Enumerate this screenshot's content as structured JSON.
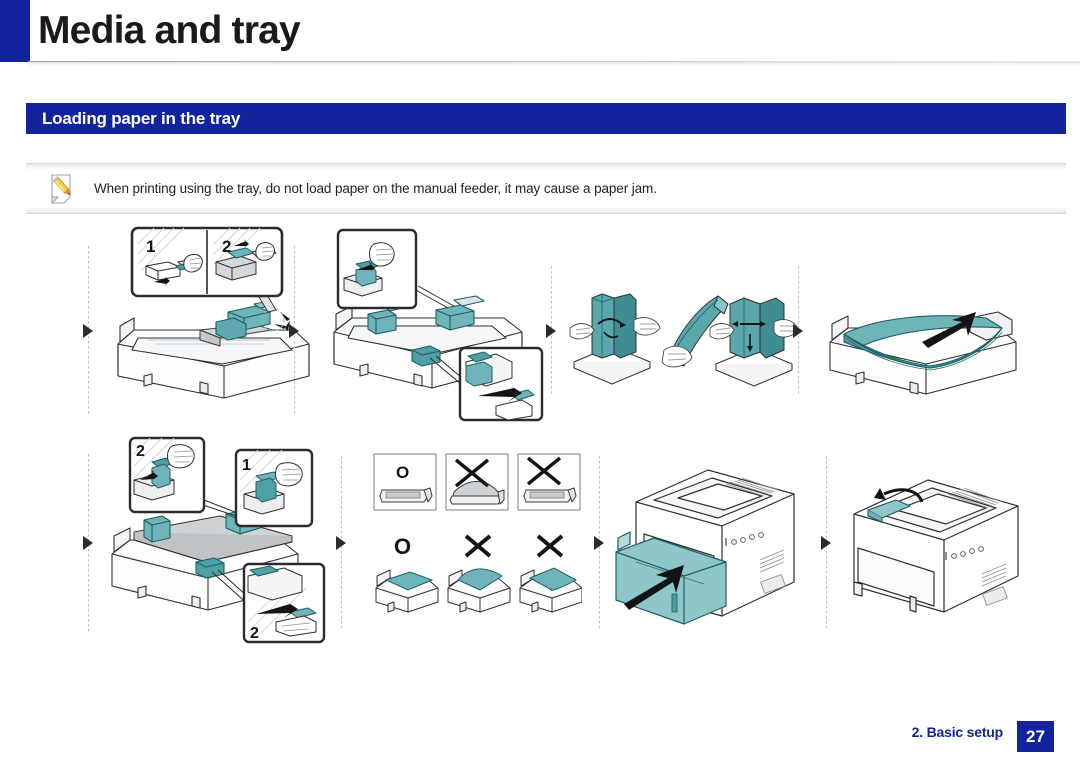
{
  "header": {
    "title": "Media and tray",
    "accent_color": "#12239e"
  },
  "section": {
    "title": "Loading paper in the tray",
    "background_color": "#12239e"
  },
  "note": {
    "icon": "note-pencil-icon",
    "text": "When printing using the tray, do not load paper on the manual feeder, it may cause a paper jam."
  },
  "illustrations": {
    "row1": [
      {
        "name": "panel-extend-tray",
        "callout_labels": [
          "1",
          "2"
        ],
        "description": "Pull out the paper tray and adjust the tray length guide"
      },
      {
        "name": "panel-adjust-guides",
        "callout_labels": [],
        "description": "Squeeze the paper width guides and the length guide into position"
      },
      {
        "name": "panel-flex-paper-stack",
        "callout_labels": [],
        "description": "Flex or fan the edge of the paper stack to separate the pages"
      },
      {
        "name": "panel-load-paper",
        "callout_labels": [],
        "description": "Load the paper with the side you want to print facing up"
      }
    ],
    "row2": [
      {
        "name": "panel-secure-guides",
        "callout_labels": [
          "2",
          "1",
          "2"
        ],
        "description": "Slide the width and length guides against the paper stack"
      },
      {
        "name": "panel-paper-condition-examples",
        "marks": [
          "O",
          "X",
          "X"
        ],
        "description": "Do not use curled, creased or bent paper"
      },
      {
        "name": "panel-insert-tray",
        "callout_labels": [],
        "description": "Insert the tray back into the printer"
      },
      {
        "name": "panel-open-output-support",
        "callout_labels": [],
        "description": "Open the output support to receive printed pages"
      }
    ]
  },
  "footer": {
    "chapter_label": "2. Basic setup",
    "page_number": "27",
    "accent_color": "#12239e"
  }
}
